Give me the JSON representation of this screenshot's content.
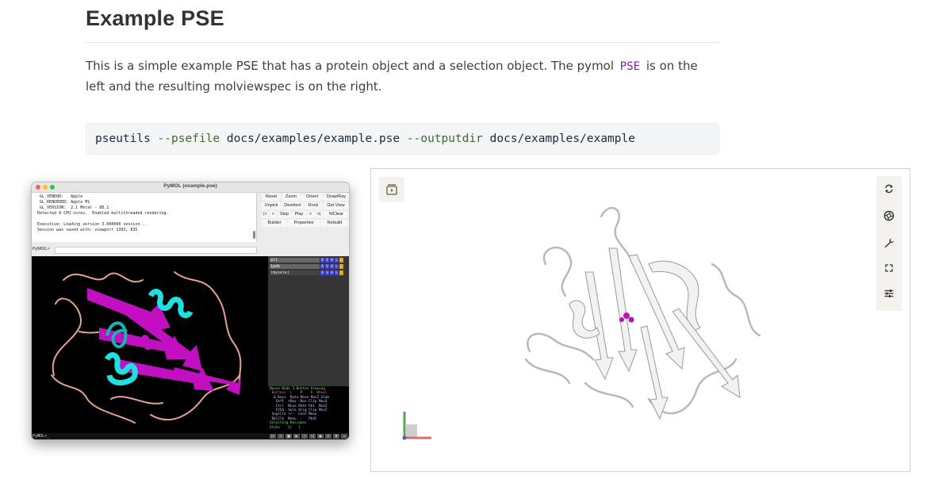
{
  "doc": {
    "heading": "Example PSE",
    "para_before": "This is a simple example PSE that has a protein object and a selection object. The pymol ",
    "para_code": "PSE",
    "para_after": " is on the left and the resulting molviewspec is on the right.",
    "command": {
      "cmd": "pseutils",
      "opt1": "--psefile",
      "arg1": "docs/examples/example.pse",
      "opt2": "--outputdir",
      "arg2": "docs/examples/example"
    }
  },
  "pymol": {
    "title": "PyMOL (example.pse)",
    "console_lines": [
      "  GL_VENDOR:   Apple",
      "  GL_RENDERER: Apple M1",
      "  GL_VERSION:  2.1 Metal - 88.1",
      " Detected 8 CPU cores.  Enabled multithreaded rendering.",
      "",
      " Executive: Loading version 3.000000 session...",
      " Session was saved with: viewport 1393, 835"
    ],
    "prompt_label": "PyMOL>",
    "buttons": {
      "reset": "Reset",
      "zoom": "Zoom",
      "orient": "Orient",
      "draw": "Draw/Ray",
      "unpick": "Unpick",
      "deselect": "Deselect",
      "rock": "Rock",
      "getview": "Get View",
      "first": "|<",
      "prev": "<",
      "stop": "Stop",
      "play": "Play",
      "next": ">",
      "last": ">|",
      "mclear": "MClear",
      "builder": "Builder",
      "properties": "Properties",
      "rebuild": "Rebuild"
    },
    "objects": [
      {
        "name": "all"
      },
      {
        "name": "1pdb"
      },
      {
        "name": "(mysele)"
      }
    ],
    "obj_btns": [
      "A",
      "S",
      "H",
      "L",
      "C"
    ],
    "mouse_lines": [
      "Mouse Mode 3-Button Viewing",
      " Buttons  L    M    R  Wheel",
      "  & Keys  Rota Move MovZ Slab",
      "   Shft  +Box -Box Clip MovS",
      "   Ctrl  Move PkAt Pk1  MvSZ",
      "   CtSh  Sele Orig Clip MovZ",
      " SnglClk +/-  Cent Menu",
      " DblClk  Menu  -   PkAt",
      "Selecting Residues",
      "State    1/   1"
    ],
    "status_text": "PyMOL>_",
    "player_btns": [
      "|<",
      "<",
      "■",
      "▶",
      ">",
      ">|",
      "●",
      "⟳",
      "▼",
      "↓"
    ]
  },
  "mvs": {
    "left_icon": "snapshot-icon",
    "right_icons": [
      "reset-camera-icon",
      "screenshot-icon",
      "tools-icon",
      "fullscreen-icon",
      "settings-icon"
    ]
  }
}
